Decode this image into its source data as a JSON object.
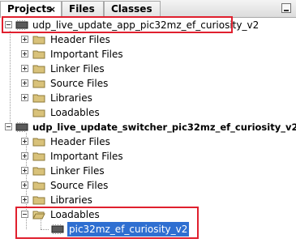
{
  "tabs": [
    {
      "label": "Projects",
      "close": "×"
    },
    {
      "label": "Files"
    },
    {
      "label": "Classes"
    }
  ],
  "tree": {
    "project1": {
      "label": "udp_live_update_app_pic32mz_ef_curiosity_v2",
      "children": [
        "Header Files",
        "Important Files",
        "Linker Files",
        "Source Files",
        "Libraries",
        "Loadables"
      ]
    },
    "project2": {
      "label": "udp_live_update_switcher_pic32mz_ef_curiosity_v2",
      "children": [
        "Header Files",
        "Important Files",
        "Linker Files",
        "Source Files",
        "Libraries",
        "Loadables"
      ],
      "loadable_item": "pic32mz_ef_curiosity_v2"
    }
  },
  "colors": {
    "highlight_box": "#e0202e",
    "selection": "#2f6fd1",
    "folder": "#d9c27a"
  }
}
